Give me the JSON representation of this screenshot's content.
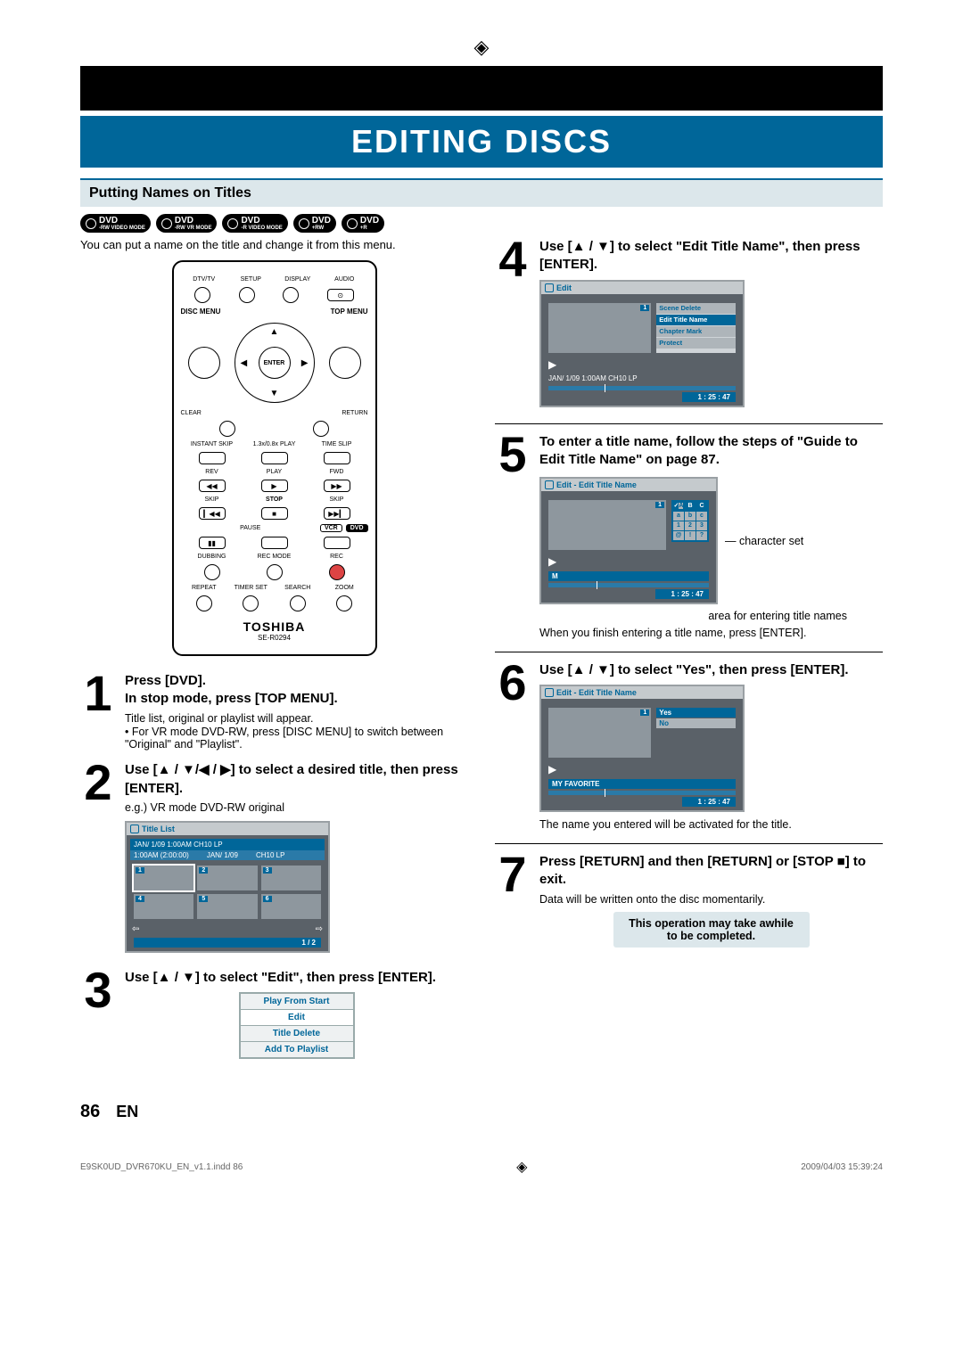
{
  "page_title": "EDITING DISCS",
  "section_title": "Putting Names on Titles",
  "disc_badges": [
    {
      "main": "DVD",
      "sub": "-RW VIDEO MODE"
    },
    {
      "main": "DVD",
      "sub": "-RW VR MODE"
    },
    {
      "main": "DVD",
      "sub": "-R VIDEO MODE"
    },
    {
      "main": "DVD",
      "sub": "+RW"
    },
    {
      "main": "DVD",
      "sub": "+R"
    }
  ],
  "intro_text": "You can put a name on the title and change it from this menu.",
  "remote": {
    "row1": [
      "DTV/TV",
      "SETUP",
      "DISPLAY",
      "AUDIO"
    ],
    "disc_menu": "DISC MENU",
    "top_menu": "TOP MENU",
    "enter": "ENTER",
    "clear": "CLEAR",
    "return_lbl": "RETURN",
    "row4": [
      "INSTANT SKIP",
      "1.3x/0.8x PLAY",
      "TIME SLIP"
    ],
    "row5": [
      "REV",
      "PLAY",
      "FWD"
    ],
    "row6": [
      "SKIP",
      "STOP",
      "SKIP"
    ],
    "row7": [
      "PAUSE",
      "VCR",
      "DVD"
    ],
    "row8": [
      "DUBBING",
      "REC MODE",
      "REC"
    ],
    "row9": [
      "REPEAT",
      "TIMER SET",
      "SEARCH",
      "ZOOM"
    ],
    "brand": "TOSHIBA",
    "model": "SE-R0294"
  },
  "steps": {
    "s1": {
      "h1": "Press [DVD].",
      "h2": "In stop mode, press [TOP MENU].",
      "line": "Title list, original or playlist will appear.",
      "bullet": "For VR mode DVD-RW, press [DISC MENU] to switch between \"Original\" and \"Playlist\"."
    },
    "s2": {
      "h": "Use [▲ / ▼/◀ / ▶] to select a desired title, then press [ENTER].",
      "sub": "e.g.) VR mode DVD-RW original",
      "screen": {
        "title": "Title List",
        "header": "JAN/ 1/09 1:00AM CH10   LP",
        "cols": [
          "1:00AM (2:00:00)",
          "JAN/ 1/09",
          "CH10  LP"
        ],
        "cells": [
          "1",
          "2",
          "3",
          "4",
          "5",
          "6"
        ],
        "footer": "1 / 2"
      }
    },
    "s3": {
      "h": "Use [▲ / ▼] to select \"Edit\", then press [ENTER].",
      "menu": [
        "Play From Start",
        "Edit",
        "Title Delete",
        "Add To Playlist"
      ]
    },
    "s4": {
      "h": "Use [▲ / ▼] to select \"Edit Title Name\", then press [ENTER].",
      "screen": {
        "title": "Edit",
        "menu": [
          "Scene Delete",
          "Edit Title Name",
          "Chapter Mark",
          "Protect"
        ],
        "status": "JAN/ 1/09 1:00AM CH10   LP",
        "time": "1 : 25 : 47"
      }
    },
    "s5": {
      "h": "To enter a title name, follow the steps of \"Guide to Edit Title Name\" on page 87.",
      "screen": {
        "title": "Edit - Edit Title Name",
        "chars_top": [
          "A",
          "B",
          "C"
        ],
        "chars": [
          "a",
          "b",
          "c",
          "1",
          "2",
          "3",
          "@",
          "!",
          "?"
        ],
        "m": "M",
        "time": "1 : 25 : 47"
      },
      "callout1": "character set",
      "callout2": "area for entering title names",
      "after": "When you finish entering a title name, press [ENTER]."
    },
    "s6": {
      "h": "Use [▲ / ▼] to select \"Yes\", then press [ENTER].",
      "screen": {
        "title": "Edit - Edit Title Name",
        "options": [
          "Yes",
          "No"
        ],
        "name": "MY FAVORITE",
        "time": "1 : 25 : 47"
      },
      "after": "The name you entered will be activated for the title."
    },
    "s7": {
      "h": "Press [RETURN] and then [RETURN] or [STOP ■] to exit.",
      "sub": "Data will be written onto the disc momentarily.",
      "warn": "This operation may take awhile to be completed."
    }
  },
  "page_number": "86",
  "page_lang": "EN",
  "doc_footer_left": "E9SK0UD_DVR670KU_EN_v1.1.indd   86",
  "doc_footer_right": "2009/04/03   15:39:24"
}
